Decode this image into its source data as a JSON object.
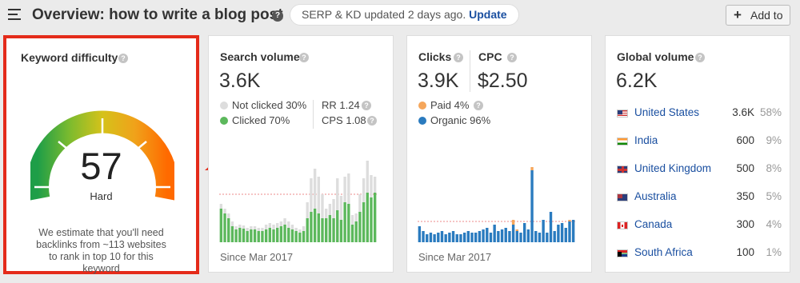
{
  "header": {
    "title": "Overview: how to write a blog post",
    "help_glyph": "?",
    "notice": "SERP & KD updated 2 days ago.",
    "update_link": "Update",
    "add_button": "Add to",
    "add_plus": "+"
  },
  "keyword_difficulty": {
    "title": "Keyword difficulty",
    "value": "57",
    "label": "Hard",
    "description": "We estimate that you'll need backlinks from ~113 websites to rank in top 10 for this keyword"
  },
  "search_volume": {
    "title": "Search volume",
    "value": "3.6K",
    "not_clicked": "Not clicked 30%",
    "clicked": "Clicked 70%",
    "rr": "RR 1.24",
    "cps": "CPS 1.08",
    "since": "Since Mar 2017",
    "colors": {
      "clicked": "#5cb85c",
      "not_clicked": "#dddddd"
    },
    "chart_data": {
      "type": "bar",
      "stacked": true,
      "series": [
        {
          "name": "Clicked",
          "values": [
            42,
            36,
            30,
            20,
            16,
            18,
            17,
            14,
            16,
            16,
            14,
            14,
            16,
            18,
            16,
            18,
            20,
            22,
            18,
            16,
            14,
            12,
            14,
            30,
            38,
            42,
            36,
            30,
            30,
            34,
            30,
            40,
            28,
            50,
            48,
            22,
            26,
            38,
            50,
            62,
            56,
            62
          ]
        },
        {
          "name": "Not clicked",
          "values": [
            6,
            6,
            6,
            6,
            4,
            4,
            4,
            4,
            4,
            4,
            4,
            4,
            6,
            6,
            6,
            6,
            6,
            8,
            8,
            6,
            4,
            4,
            6,
            20,
            42,
            50,
            46,
            30,
            12,
            14,
            24,
            40,
            30,
            32,
            38,
            12,
            10,
            22,
            30,
            40,
            28,
            20
          ]
        }
      ]
    }
  },
  "clicks_cpc": {
    "clicks_title": "Clicks",
    "clicks_value": "3.9K",
    "cpc_title": "CPC",
    "cpc_value": "$2.50",
    "paid": "Paid 4%",
    "organic": "Organic 96%",
    "since": "Since Mar 2017",
    "colors": {
      "paid": "#f5a65b",
      "organic": "#2a7bbf"
    },
    "chart_data": {
      "type": "bar",
      "stacked": true,
      "series": [
        {
          "name": "Organic",
          "values": [
            20,
            14,
            10,
            12,
            10,
            12,
            14,
            10,
            12,
            14,
            10,
            10,
            12,
            14,
            12,
            12,
            14,
            16,
            18,
            12,
            22,
            14,
            16,
            18,
            14,
            22,
            14,
            12,
            24,
            16,
            90,
            14,
            12,
            28,
            12,
            38,
            14,
            22,
            24,
            18,
            26,
            28
          ]
        },
        {
          "name": "Paid",
          "values": [
            0,
            0,
            0,
            0,
            0,
            0,
            0,
            0,
            0,
            0,
            0,
            0,
            0,
            0,
            0,
            0,
            0,
            0,
            0,
            0,
            0,
            0,
            0,
            0,
            0,
            6,
            2,
            0,
            0,
            0,
            4,
            0,
            0,
            0,
            0,
            0,
            0,
            0,
            0,
            0,
            2,
            0
          ]
        }
      ]
    }
  },
  "global_volume": {
    "title": "Global volume",
    "value": "6.2K",
    "countries": [
      {
        "name": "United States",
        "volume": "3.6K",
        "pct": "58%",
        "flag": "us-flag"
      },
      {
        "name": "India",
        "volume": "600",
        "pct": "9%",
        "flag": "in-flag"
      },
      {
        "name": "United Kingdom",
        "volume": "500",
        "pct": "8%",
        "flag": "gb-flag"
      },
      {
        "name": "Australia",
        "volume": "350",
        "pct": "5%",
        "flag": "au-flag"
      },
      {
        "name": "Canada",
        "volume": "300",
        "pct": "4%",
        "flag": "ca-flag"
      },
      {
        "name": "South Africa",
        "volume": "100",
        "pct": "1%",
        "flag": "za-flag"
      }
    ]
  }
}
